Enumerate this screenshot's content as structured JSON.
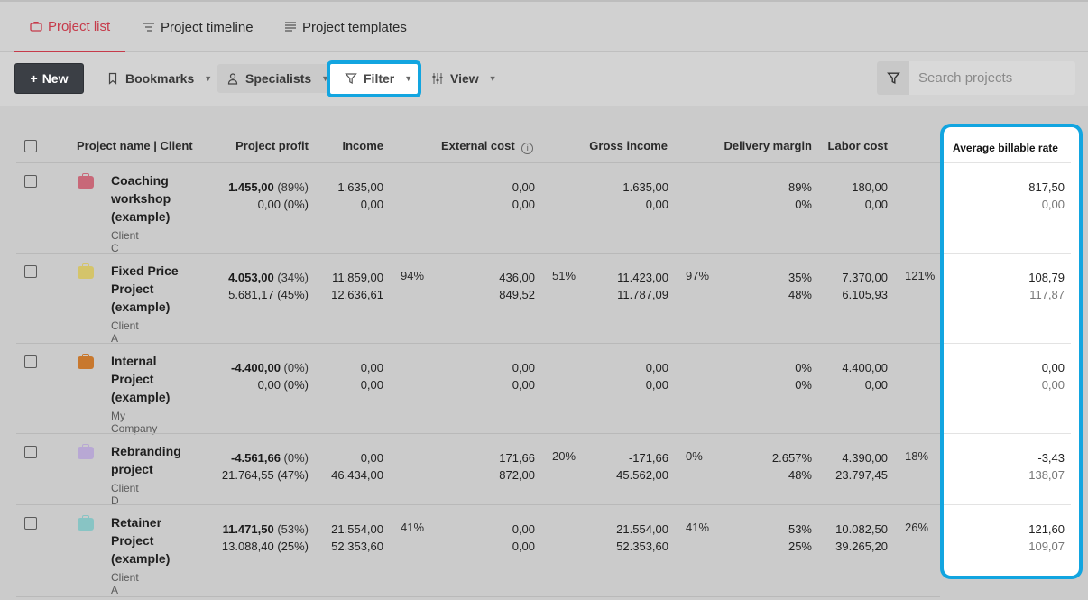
{
  "tabs": [
    {
      "label": "Project list",
      "active": true,
      "icon": "briefcase-icon"
    },
    {
      "label": "Project timeline",
      "active": false,
      "icon": "timeline-icon"
    },
    {
      "label": "Project templates",
      "active": false,
      "icon": "template-icon"
    }
  ],
  "toolbar": {
    "new_label": "New",
    "bookmarks_label": "Bookmarks",
    "specialists_label": "Specialists",
    "filter_label": "Filter",
    "view_label": "View",
    "search_placeholder": "Search projects"
  },
  "columns": {
    "name": "Project name | Client",
    "profit": "Project profit",
    "income": "Income",
    "external_cost": "External cost",
    "gross_income": "Gross income",
    "delivery_margin": "Delivery margin",
    "labor_cost": "Labor cost",
    "avg_rate": "Average billable rate"
  },
  "colors": {
    "accent": "#c63a4a",
    "highlight": "#12a5e0"
  },
  "rows": [
    {
      "name": "Coaching workshop (example)",
      "client": "Client C",
      "color": "#c86878",
      "profit_main": "1.455,00",
      "profit_main_pct": "(89%)",
      "profit_sub": "0,00 (0%)",
      "income": "1.635,00",
      "income_sub": "0,00",
      "income_pct": "",
      "ext": "0,00",
      "ext_sub": "0,00",
      "ext_pct": "",
      "gross": "1.635,00",
      "gross_sub": "0,00",
      "gross_pct": "",
      "margin": "89%",
      "margin_sub": "0%",
      "labor": "180,00",
      "labor_sub": "0,00",
      "labor_pct": "",
      "rate": "817,50",
      "rate_sub": "0,00"
    },
    {
      "name": "Fixed Price Project (example)",
      "client": "Client A",
      "color": "#d4c46a",
      "profit_main": "4.053,00",
      "profit_main_pct": "(34%)",
      "profit_sub": "5.681,17 (45%)",
      "income": "11.859,00",
      "income_sub": "12.636,61",
      "income_pct": "94%",
      "ext": "436,00",
      "ext_sub": "849,52",
      "ext_pct": "51%",
      "gross": "11.423,00",
      "gross_sub": "11.787,09",
      "gross_pct": "97%",
      "margin": "35%",
      "margin_sub": "48%",
      "labor": "7.370,00",
      "labor_sub": "6.105,93",
      "labor_pct": "121%",
      "rate": "108,79",
      "rate_sub": "117,87"
    },
    {
      "name": "Internal Project (example)",
      "client": "My Company",
      "color": "#c8782e",
      "profit_main": "-4.400,00",
      "profit_main_pct": "(0%)",
      "profit_sub": "0,00 (0%)",
      "income": "0,00",
      "income_sub": "0,00",
      "income_pct": "",
      "ext": "0,00",
      "ext_sub": "0,00",
      "ext_pct": "",
      "gross": "0,00",
      "gross_sub": "0,00",
      "gross_pct": "",
      "margin": "0%",
      "margin_sub": "0%",
      "labor": "4.400,00",
      "labor_sub": "0,00",
      "labor_pct": "",
      "rate": "0,00",
      "rate_sub": "0,00"
    },
    {
      "name": "Rebranding project",
      "client": "Client D",
      "color": "#b8a8d4",
      "profit_main": "-4.561,66",
      "profit_main_pct": "(0%)",
      "profit_sub": "21.764,55 (47%)",
      "income": "0,00",
      "income_sub": "46.434,00",
      "income_pct": "",
      "ext": "171,66",
      "ext_sub": "872,00",
      "ext_pct": "20%",
      "gross": "-171,66",
      "gross_sub": "45.562,00",
      "gross_pct": "0%",
      "margin": "2.657%",
      "margin_sub": "48%",
      "labor": "4.390,00",
      "labor_sub": "23.797,45",
      "labor_pct": "18%",
      "rate": "-3,43",
      "rate_sub": "138,07"
    },
    {
      "name": "Retainer Project (example)",
      "client": "Client A",
      "color": "#88c4c4",
      "profit_main": "11.471,50",
      "profit_main_pct": "(53%)",
      "profit_sub": "13.088,40 (25%)",
      "income": "21.554,00",
      "income_sub": "52.353,60",
      "income_pct": "41%",
      "ext": "0,00",
      "ext_sub": "0,00",
      "ext_pct": "",
      "gross": "21.554,00",
      "gross_sub": "52.353,60",
      "gross_pct": "41%",
      "margin": "53%",
      "margin_sub": "25%",
      "labor": "10.082,50",
      "labor_sub": "39.265,20",
      "labor_pct": "26%",
      "rate": "121,60",
      "rate_sub": "109,07"
    }
  ]
}
